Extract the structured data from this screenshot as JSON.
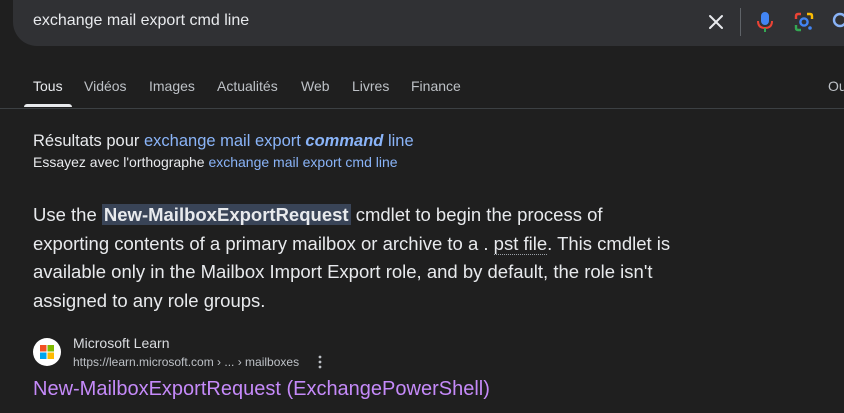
{
  "search": {
    "query": "exchange mail export cmd line"
  },
  "icons": {
    "clear": "close-icon",
    "mic": "microphone-icon",
    "lens": "google-lens-icon",
    "search": "search-icon"
  },
  "tabs": [
    {
      "label": "Tous",
      "active": true
    },
    {
      "label": "Vidéos"
    },
    {
      "label": "Images"
    },
    {
      "label": "Actualités"
    },
    {
      "label": "Web"
    },
    {
      "label": "Livres"
    },
    {
      "label": "Finance"
    },
    {
      "label": "Ou"
    }
  ],
  "spelling": {
    "prefix": "Résultats pour",
    "corrected_part1": "exchange mail export",
    "corrected_bold": "command",
    "corrected_part2": "line",
    "try_prefix": "Essayez avec l'orthographe",
    "original_query": "exchange mail export cmd line"
  },
  "snippet": {
    "before": "Use the",
    "highlight": "New-MailboxExportRequest",
    "middle": "cmdlet to begin the process of exporting contents of a primary mailbox or archive to a .",
    "dotted": "pst file",
    "after": ". This cmdlet is available only in the Mailbox Import Export role, and by default, the role isn't assigned to any role groups."
  },
  "result": {
    "source_name": "Microsoft Learn",
    "url": "https://learn.microsoft.com › ... › mailboxes",
    "title": "New-MailboxExportRequest (ExchangePowerShell)"
  },
  "colors": {
    "background": "#1f1f1f",
    "link": "#8ab4f8",
    "visited_title": "#c58af9",
    "highlight": "#394457"
  }
}
